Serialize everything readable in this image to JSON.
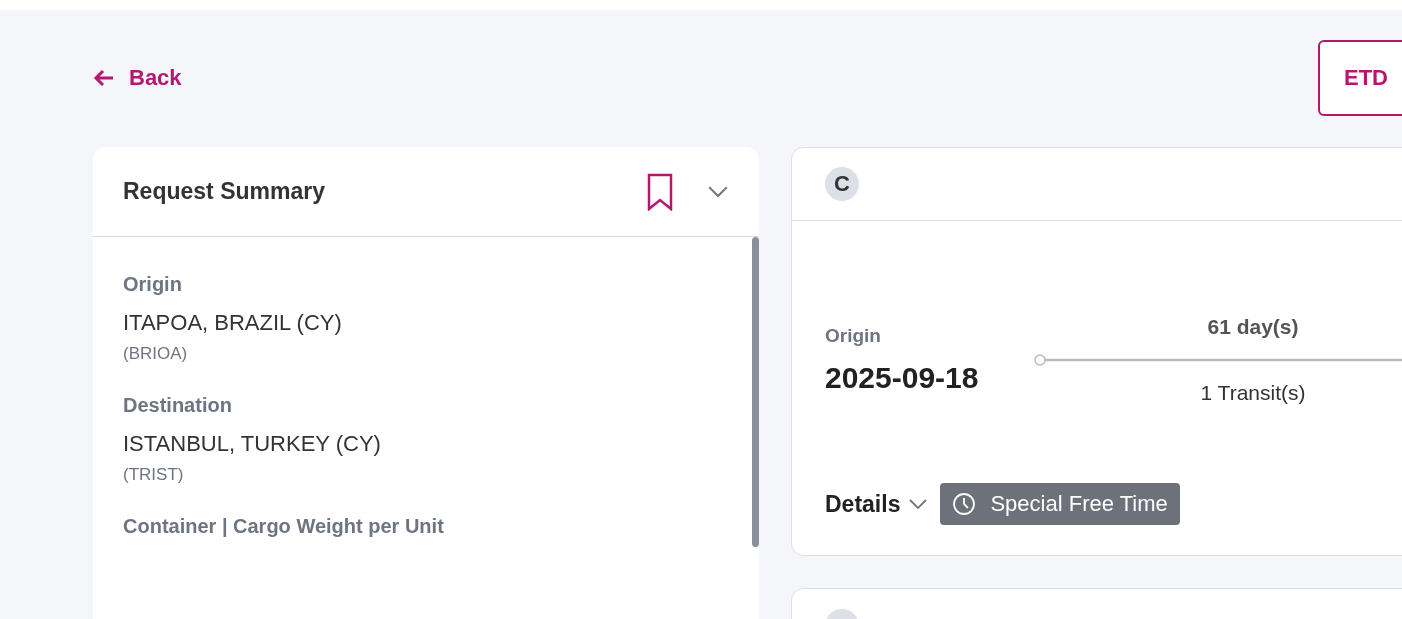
{
  "back_link": {
    "label": "Back"
  },
  "etd_button": {
    "label": "ETD"
  },
  "request_summary": {
    "title": "Request Summary",
    "fields": [
      {
        "label": "Origin",
        "value": "ITAPOA, BRAZIL (CY)",
        "code": "(BRIOA)"
      },
      {
        "label": "Destination",
        "value": "ISTANBUL, TURKEY (CY)",
        "code": "(TRIST)"
      },
      {
        "label": "Container | Cargo Weight per Unit"
      }
    ]
  },
  "results": [
    {
      "carrier_initial": "C",
      "origin_label": "Origin",
      "origin_date": "2025-09-18",
      "duration": "61 day(s)",
      "transits": "1 Transit(s)",
      "details_label": "Details",
      "tag": "Special Free Time"
    }
  ]
}
